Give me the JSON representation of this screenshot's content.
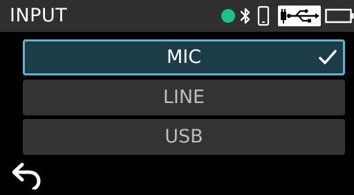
{
  "header": {
    "title": "INPUT",
    "status_icons": [
      "status-dot",
      "bluetooth-icon",
      "phone-icon",
      "usb-plug-icon",
      "battery-icon"
    ]
  },
  "options": [
    {
      "label": "MIC",
      "selected": true
    },
    {
      "label": "LINE",
      "selected": false
    },
    {
      "label": "USB",
      "selected": false
    }
  ],
  "footer": {
    "back_icon": "back-arrow-icon"
  },
  "colors": {
    "header_bg": "#2f2f2f",
    "status_dot": "#19c28a",
    "selected_bg": "#1c3d47",
    "selected_border": "#5ab8d4",
    "option_bg": "#333333",
    "option_text": "#bdbdbd",
    "selected_text": "#ffffff"
  }
}
